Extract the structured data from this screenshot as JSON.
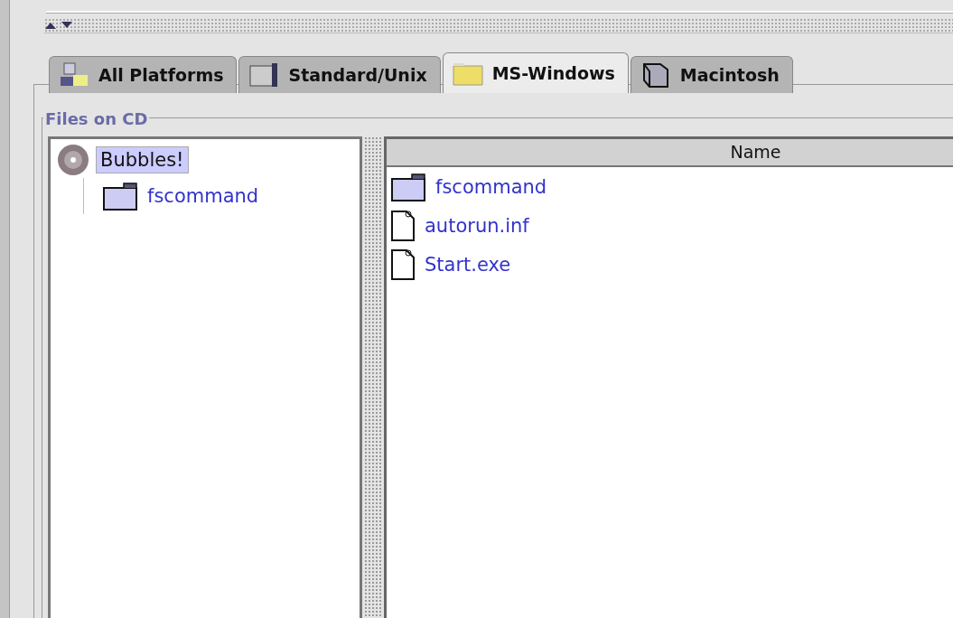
{
  "tabs": [
    {
      "label": "All Platforms",
      "selected": false,
      "kind": "platforms"
    },
    {
      "label": "Standard/Unix",
      "selected": false,
      "kind": "unix"
    },
    {
      "label": "MS-Windows",
      "selected": true,
      "kind": "windows"
    },
    {
      "label": "Macintosh",
      "selected": false,
      "kind": "mac"
    }
  ],
  "group": {
    "title": "Files on CD"
  },
  "tree": [
    {
      "label": "Bubbles!",
      "kind": "disc",
      "selected": true,
      "children": [
        {
          "label": "fscommand",
          "kind": "folder",
          "selected": false
        }
      ]
    }
  ],
  "table": {
    "columns": [
      "Name"
    ],
    "rows": [
      {
        "name": "fscommand",
        "kind": "folder"
      },
      {
        "name": "autorun.inf",
        "kind": "file"
      },
      {
        "name": "Start.exe",
        "kind": "file"
      }
    ]
  }
}
